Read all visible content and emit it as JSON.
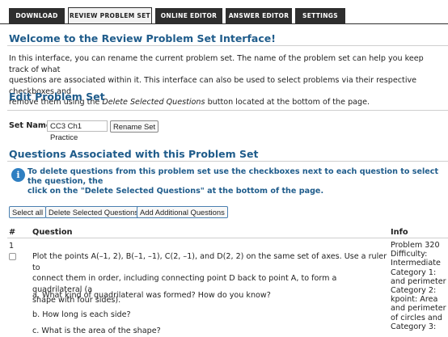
{
  "tabs": [
    {
      "label": "DOWNLOAD",
      "active": false
    },
    {
      "label": "REVIEW PROBLEM SET",
      "active": true
    },
    {
      "label": "ONLINE EDITOR",
      "active": false
    },
    {
      "label": "ANSWER EDITOR",
      "active": false
    },
    {
      "label": "SETTINGS",
      "active": false
    }
  ],
  "welcome": {
    "title": "Welcome to the Review Problem Set Interface!",
    "para_1": "In this interface, you can rename the current problem set. The name of the problem set can help you keep track of what",
    "para_2": "questions are associated within it. This interface can also be used to select problems via their respective checkboxes and",
    "para_3_before": "remove them using the ",
    "para_3_em": "Delete Selected Questions",
    "para_3_after": " button located at the bottom of the page."
  },
  "edit": {
    "title": "Edit Problem Set",
    "set_name_label": "Set Name:",
    "set_name_value": "CC3 Ch1 Practice",
    "rename_button": "Rename Set"
  },
  "questions": {
    "title": "Questions Associated with this Problem Set",
    "info_icon_glyph": "i",
    "notice_1": "To delete questions from this problem set use the checkboxes next to each question to select the question, the",
    "notice_2": "click on the \"Delete Selected Questions\" at the bottom of the page.",
    "select_all": "Select all",
    "delete_selected": "Delete Selected Questions",
    "add_additional": "Add Additional Questions",
    "col_num": "#",
    "col_question": "Question",
    "col_info": "Info"
  },
  "row": {
    "num": "1",
    "q_line_1": "Plot the points A(–1, 2), B(–1, –1), C(2, –1), and D(2, 2) on the same set of axes. Use a ruler to",
    "q_line_2": "connect them in order, including connecting point D back to point A, to form a quadrilateral (a",
    "q_line_3": "shape with four sides).",
    "q_a": "a. What kind of quadrilateral was formed? How do you know?",
    "q_b": "b. How long is each side?",
    "q_c": "c. What is the area of the shape?",
    "info_lines": [
      "Problem 320",
      "Difficulty:",
      "Intermediate",
      "Category 1:",
      "and perimeter",
      "Category 2:",
      "kpoint: Area",
      "and perimeter",
      "of circles and",
      "Category 3:"
    ]
  }
}
